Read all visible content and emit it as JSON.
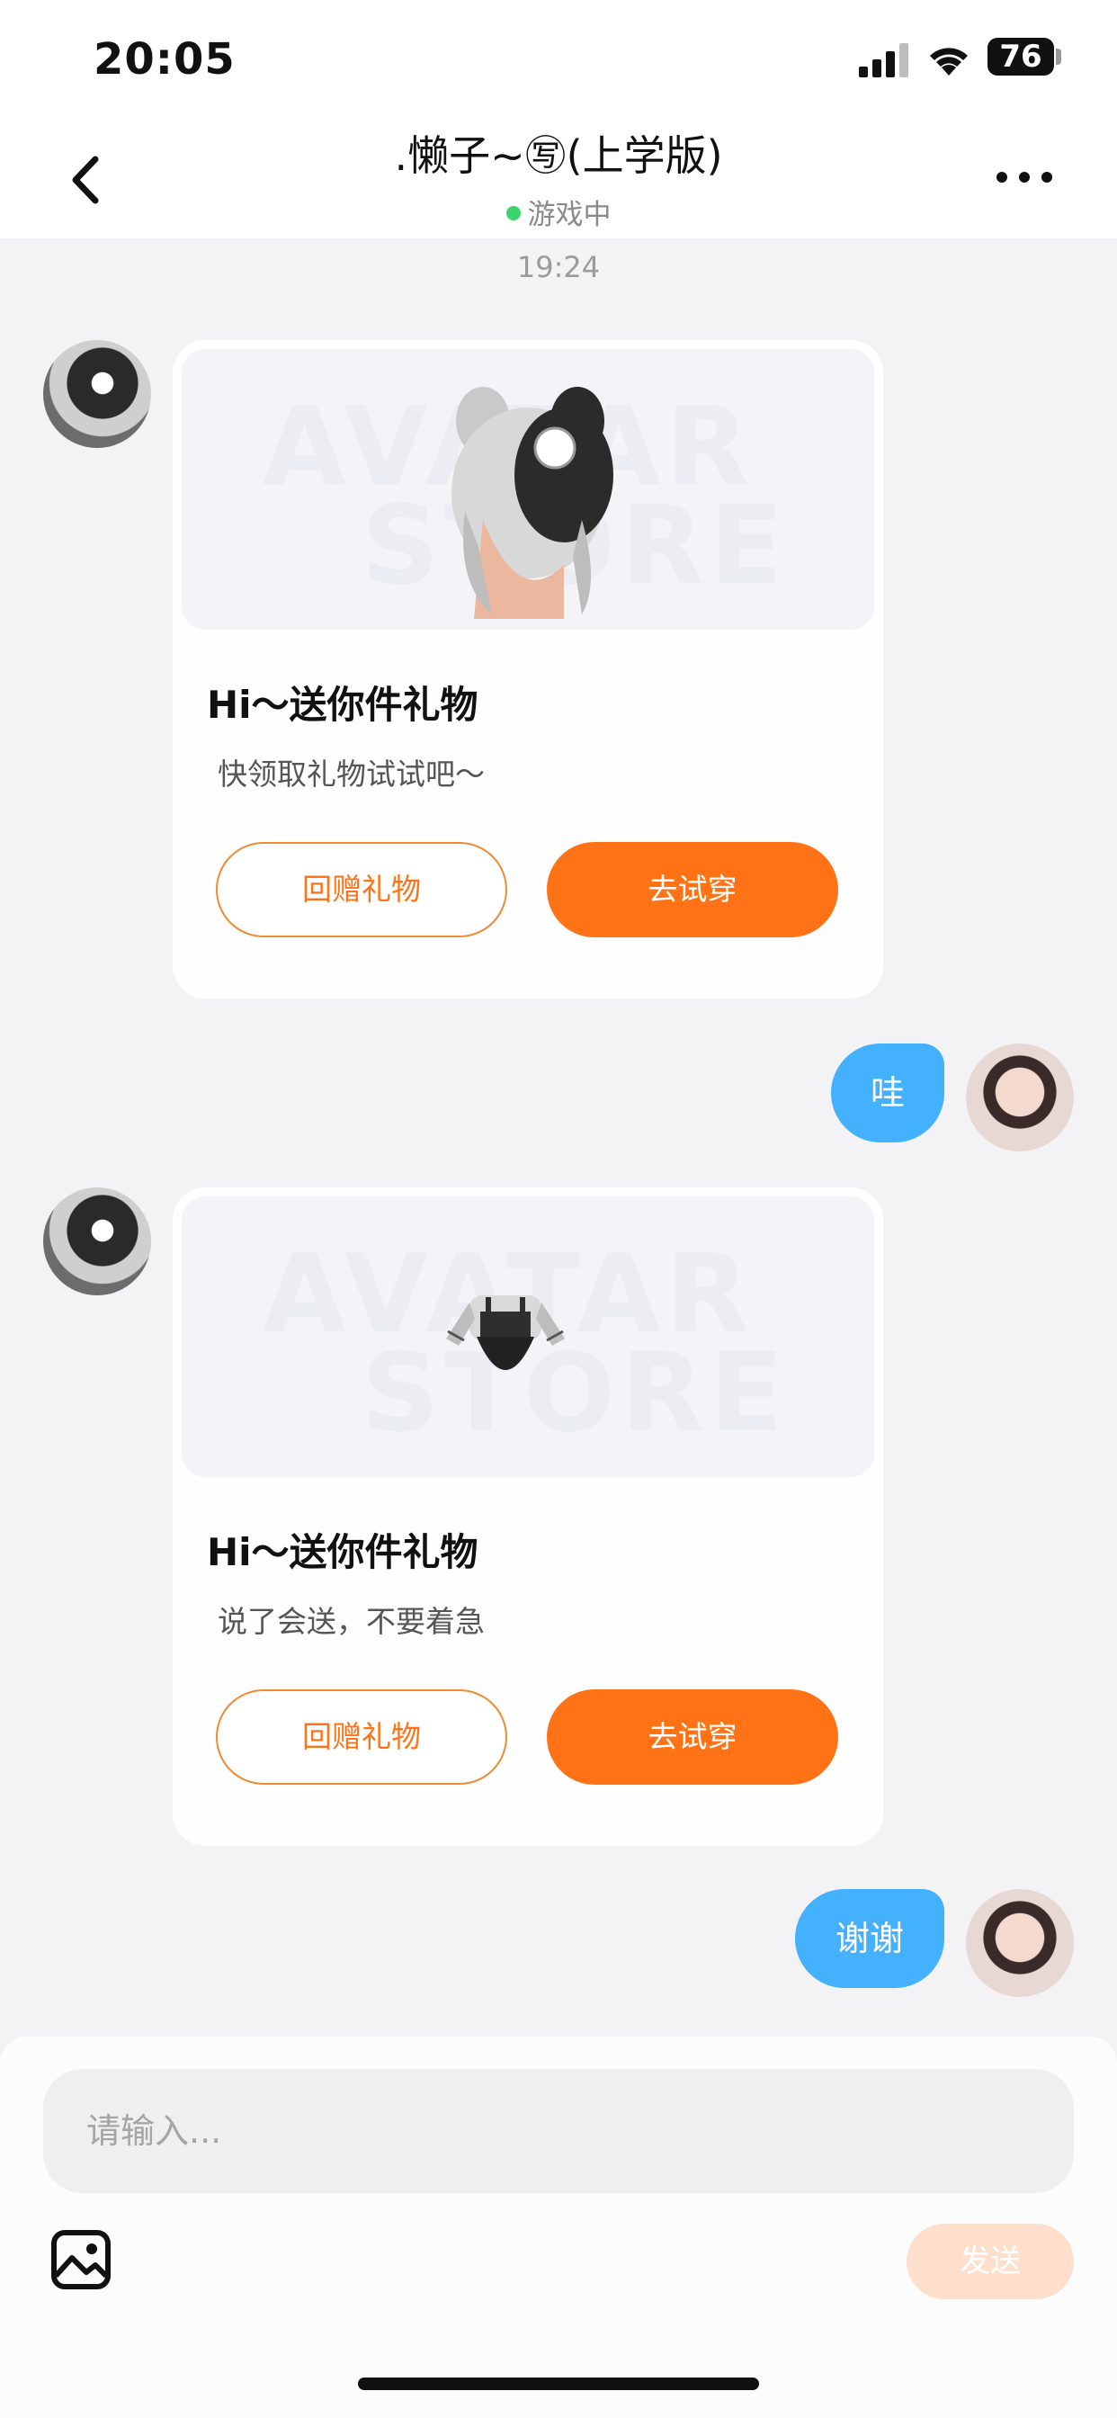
{
  "status_bar": {
    "time": "20:05",
    "battery": "76"
  },
  "header": {
    "title": ".懒子~㊢(上学版)",
    "status": "游戏中"
  },
  "timestamp": "19:24",
  "watermark": {
    "line1": "AVATAR",
    "line2": "STORE"
  },
  "messages": [
    {
      "type": "gift_card",
      "title": "Hi～送你件礼物",
      "description": "快领取礼物试试吧～",
      "secondary_button": "回赠礼物",
      "primary_button": "去试穿"
    },
    {
      "type": "text",
      "text": "哇"
    },
    {
      "type": "gift_card",
      "title": "Hi～送你件礼物",
      "description": "说了会送，不要着急",
      "secondary_button": "回赠礼物",
      "primary_button": "去试穿"
    },
    {
      "type": "text",
      "text": "谢谢"
    }
  ],
  "composer": {
    "placeholder": "请输入...",
    "send_label": "发送"
  },
  "colors": {
    "accent": "#ff7316",
    "bubble": "#44b1ff",
    "online": "#3dd46b",
    "send_disabled": "#fddfcc"
  }
}
